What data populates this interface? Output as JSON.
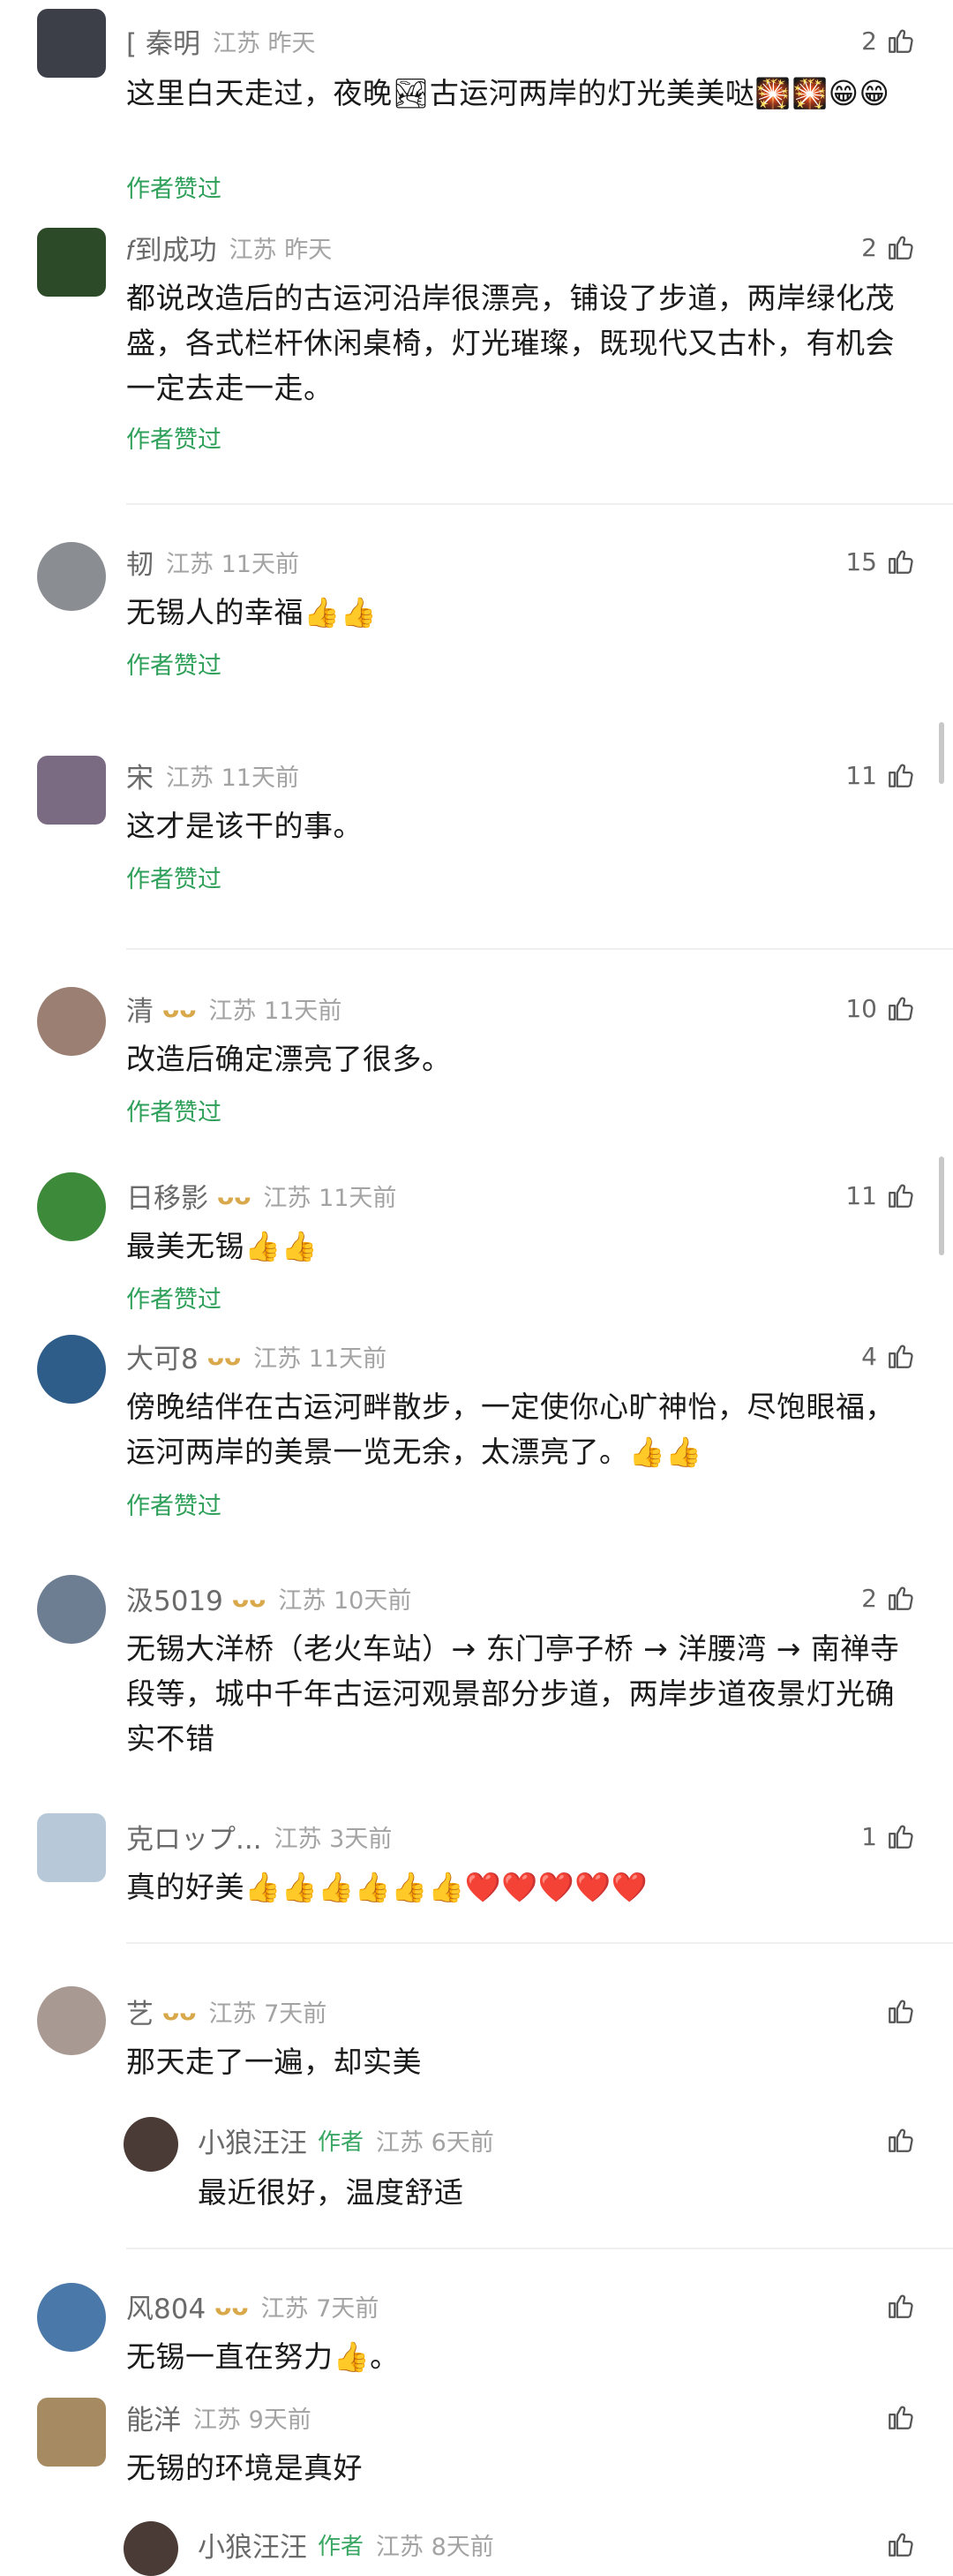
{
  "colors": {
    "accent_green": "#2fa05a",
    "meta_gray": "#a3a3a3",
    "heart_red": "#ef3b5c",
    "vip_gold": "#d8a84a"
  },
  "icons": {
    "like": "thumbs-up-outline-icon",
    "vip": "vip-badge-icon"
  },
  "comments": [
    {
      "name": "[ 秦明",
      "meta": "江苏 昨天",
      "likes": "2",
      "text": "这里白天走过，夜晚🏞古运河两岸的灯光美美哒🎇🎇😁😁",
      "liked_label": "作者赞过"
    },
    {
      "name": "𝑓到成功",
      "meta": "江苏 昨天",
      "likes": "2",
      "text": "都说改造后的古运河沿岸很漂亮，铺设了步道，两岸绿化茂盛，各式栏杆休闲桌椅，灯光璀璨，既现代又古朴，有机会一定去走一走。",
      "liked_label": "作者赞过"
    },
    {
      "name": "韧",
      "meta": "江苏 11天前",
      "likes": "15",
      "text": "无锡人的幸福👍👍",
      "liked_label": "作者赞过"
    },
    {
      "name": "宋",
      "meta": "江苏 11天前",
      "likes": "11",
      "text": "这才是该干的事。",
      "liked_label": "作者赞过"
    },
    {
      "name": "清",
      "meta": "江苏 11天前",
      "likes": "10",
      "text": "改造后确定漂亮了很多。",
      "liked_label": "作者赞过"
    },
    {
      "name": "日移影",
      "meta": "江苏 11天前",
      "likes": "11",
      "text": "最美无锡👍👍",
      "liked_label": "作者赞过"
    },
    {
      "name": "大可8",
      "meta": "江苏 11天前",
      "likes": "4",
      "text": "傍晚结伴在古运河畔散步，一定使你心旷神怡，尽饱眼福，运河两岸的美景一览无余，太漂亮了。👍👍",
      "liked_label": "作者赞过"
    },
    {
      "name": "汲5019",
      "meta": "江苏 10天前",
      "likes": "2",
      "text": "无锡大洋桥（老火车站）→ 东门亭子桥 → 洋腰湾 → 南禅寺段等，城中千年古运河观景部分步道，两岸步道夜景灯光确实不错"
    },
    {
      "name": "克ロップ...",
      "meta": "江苏 3天前",
      "likes": "1",
      "text": "真的好美👍👍👍👍👍👍❤️❤️❤️❤️❤️"
    },
    {
      "name": "艺",
      "meta": "江苏 7天前",
      "likes": "",
      "text": "那天走了一遍，却实美"
    },
    {
      "name": "小狼汪汪",
      "author_tag": "作者",
      "meta": "江苏 6天前",
      "likes": "",
      "text": "最近很好，温度舒适"
    },
    {
      "name": "风804",
      "meta": "江苏 7天前",
      "likes": "",
      "text": "无锡一直在努力👍。"
    },
    {
      "name": "能洋",
      "meta": "江苏 9天前",
      "likes": "",
      "text": "无锡的环境是真好"
    },
    {
      "name": "小狼汪汪",
      "author_tag": "作者",
      "meta": "江苏 8天前",
      "likes": "",
      "text": ""
    }
  ]
}
